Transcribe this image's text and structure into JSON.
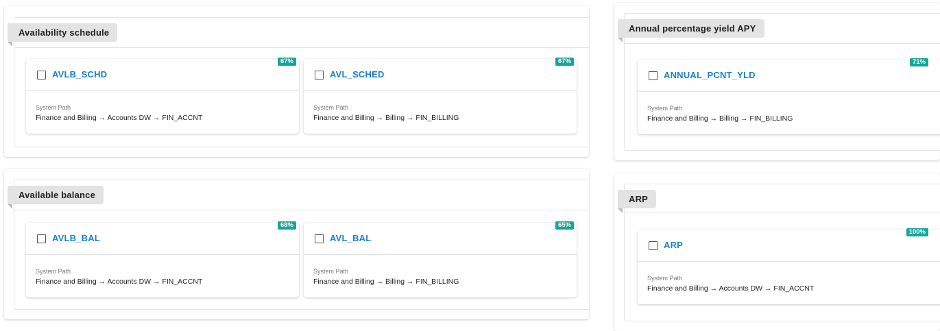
{
  "groups": [
    {
      "title": "Availability schedule",
      "cards": [
        {
          "name": "AVLB_SCHD",
          "score": "67%",
          "path_label": "System Path",
          "path": "Finance and Billing → Accounts DW → FIN_ACCNT"
        },
        {
          "name": "AVL_SCHED",
          "score": "67%",
          "path_label": "System Path",
          "path": "Finance and Billing → Billing → FIN_BILLING"
        }
      ]
    },
    {
      "title": "Available balance",
      "cards": [
        {
          "name": "AVLB_BAL",
          "score": "68%",
          "path_label": "System Path",
          "path": "Finance and Billing → Accounts DW → FIN_ACCNT"
        },
        {
          "name": "AVL_BAL",
          "score": "65%",
          "path_label": "System Path",
          "path": "Finance and Billing → Billing → FIN_BILLING"
        }
      ]
    },
    {
      "title": "Annual percentage yield APY",
      "cards": [
        {
          "name": "ANNUAL_PCNT_YLD",
          "score": "71%",
          "path_label": "System Path",
          "path": "Finance and Billing → Billing → FIN_BILLING"
        }
      ]
    },
    {
      "title": "ARP",
      "cards": [
        {
          "name": "ARP",
          "score": "100%",
          "path_label": "System Path",
          "path": "Finance and Billing → Accounts DW → FIN_ACCNT"
        }
      ]
    }
  ]
}
